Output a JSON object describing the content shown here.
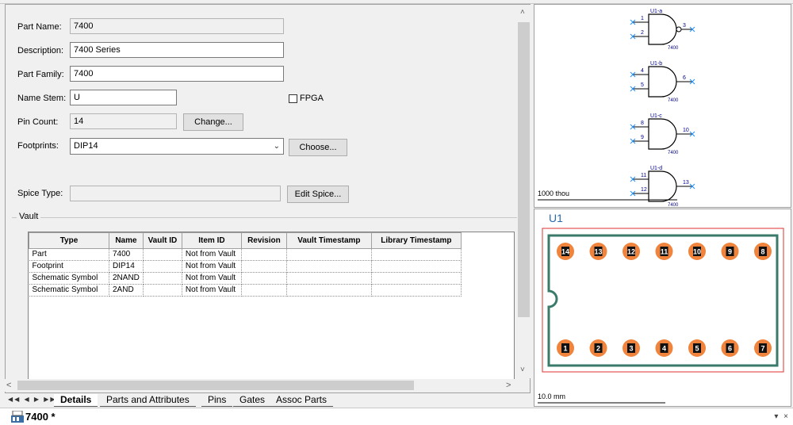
{
  "form": {
    "part_name_label": "Part Name:",
    "part_name_value": "7400",
    "description_label": "Description:",
    "description_value": "7400 Series",
    "part_family_label": "Part Family:",
    "part_family_value": "7400",
    "name_stem_label": "Name Stem:",
    "name_stem_value": "U",
    "fpga_label": "FPGA",
    "pin_count_label": "Pin Count:",
    "pin_count_value": "14",
    "change_button": "Change...",
    "footprints_label": "Footprints:",
    "footprints_value": "DIP14",
    "choose_button": "Choose...",
    "spice_type_label": "Spice Type:",
    "spice_type_value": "",
    "edit_spice_button": "Edit Spice..."
  },
  "vault": {
    "group_label": "Vault",
    "columns": [
      "Type",
      "Name",
      "Vault ID",
      "Item ID",
      "Revision",
      "Vault Timestamp",
      "Library Timestamp"
    ],
    "rows": [
      [
        "Part",
        "7400",
        "",
        "Not from Vault",
        "",
        "",
        ""
      ],
      [
        "Footprint",
        "DIP14",
        "",
        "Not from Vault",
        "",
        "",
        ""
      ],
      [
        "Schematic Symbol",
        "2NAND",
        "",
        "Not from Vault",
        "",
        "",
        ""
      ],
      [
        "Schematic Symbol",
        "2AND",
        "",
        "Not from Vault",
        "",
        "",
        ""
      ]
    ]
  },
  "tabs": [
    "Details",
    "Parts and Attributes",
    "Pins",
    "Gates",
    "Assoc Parts"
  ],
  "schematic": {
    "scale_label": "1000 thou",
    "gates": [
      {
        "ref": "U1-a",
        "in1": "1",
        "in2": "2",
        "out": "3",
        "part": "7400",
        "inverted": true
      },
      {
        "ref": "U1-b",
        "in1": "4",
        "in2": "5",
        "out": "6",
        "part": "7400",
        "inverted": false
      },
      {
        "ref": "U1-c",
        "in1": "8",
        "in2": "9",
        "out": "10",
        "part": "7400",
        "inverted": false
      },
      {
        "ref": "U1-d",
        "in1": "11",
        "in2": "12",
        "out": "13",
        "part": "7400",
        "inverted": false
      }
    ]
  },
  "footprint": {
    "ref_label": "U1",
    "scale_label": "10.0 mm",
    "top_pins": [
      "14",
      "13",
      "12",
      "11",
      "10",
      "9",
      "8"
    ],
    "bottom_pins": [
      "1",
      "2",
      "3",
      "4",
      "5",
      "6",
      "7"
    ],
    "pad_color": "#f0843c",
    "outline_color": "#3a7a6a",
    "boundary_color": "#e03030"
  },
  "document_tab": {
    "title": "7400 *"
  },
  "window_controls": {
    "pin_icon": "▾",
    "close_icon": "×"
  }
}
